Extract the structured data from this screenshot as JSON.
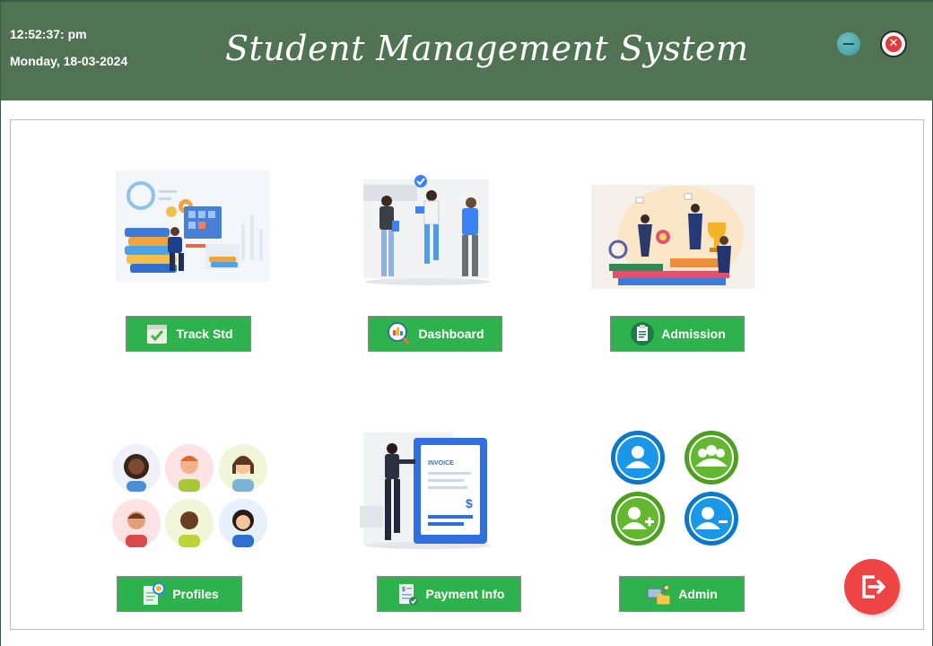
{
  "header": {
    "time": "12:52:37: pm",
    "date": "Monday, 18-03-2024",
    "title": "Student Management System"
  },
  "colors": {
    "header_bg": "#507453",
    "button_green": "#2eb24d",
    "logout_red": "#ef4444"
  },
  "window_controls": {
    "minimize_icon": "minimize-icon",
    "close_icon": "close-icon"
  },
  "menu": {
    "track_std": "Track Std",
    "dashboard": "Dashboard",
    "admission": "Admission",
    "profiles": "Profiles",
    "payment_info": "Payment Info",
    "admin": "Admin"
  },
  "illustrations": {
    "invoice_label": "INVOICE",
    "dollar": "$"
  },
  "logout": {
    "icon": "logout-icon"
  }
}
